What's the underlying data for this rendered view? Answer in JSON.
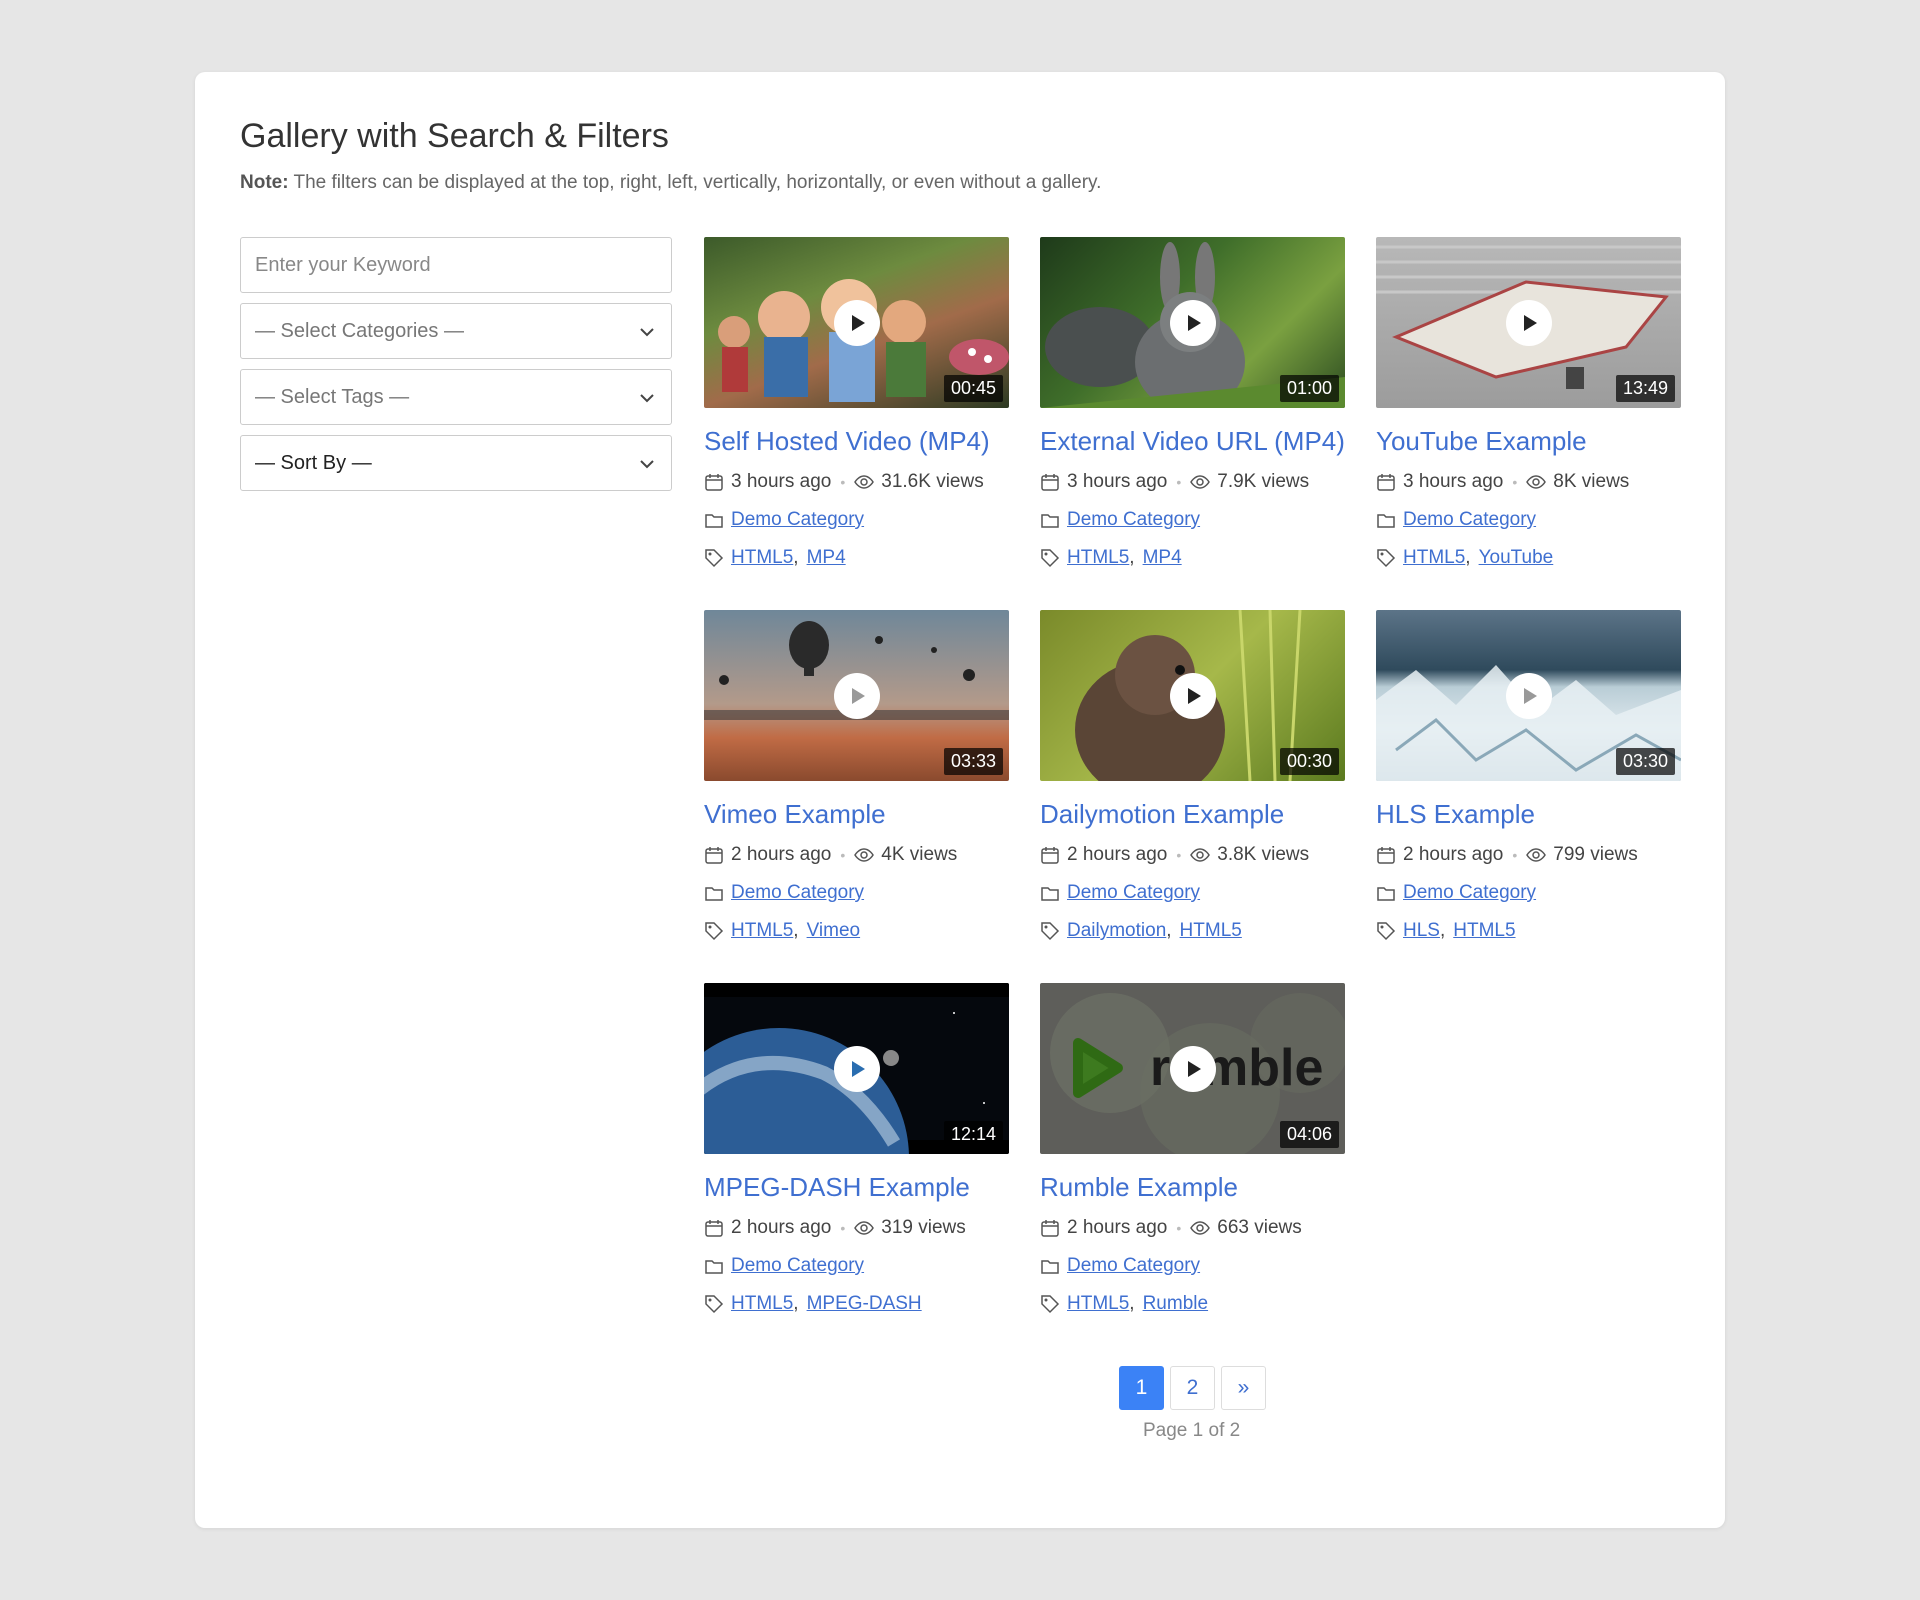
{
  "header": {
    "title": "Gallery with Search & Filters",
    "note_label": "Note:",
    "note_text": "The filters can be displayed at the top, right, left, vertically, horizontally, or even without a gallery."
  },
  "filters": {
    "keyword_placeholder": "Enter your Keyword",
    "categories": "— Select Categories —",
    "tags": "— Select Tags —",
    "sort": "— Sort By —"
  },
  "videos": [
    {
      "title": "Self Hosted Video (MP4)",
      "duration": "00:45",
      "time": "3 hours ago",
      "views": "31.6K views",
      "category": "Demo Category",
      "tag1": "HTML5",
      "tag2": "MP4"
    },
    {
      "title": "External Video URL (MP4)",
      "duration": "01:00",
      "time": "3 hours ago",
      "views": "7.9K views",
      "category": "Demo Category",
      "tag1": "HTML5",
      "tag2": "MP4"
    },
    {
      "title": "YouTube Example",
      "duration": "13:49",
      "time": "3 hours ago",
      "views": "8K views",
      "category": "Demo Category",
      "tag1": "HTML5",
      "tag2": "YouTube"
    },
    {
      "title": "Vimeo Example",
      "duration": "03:33",
      "time": "2 hours ago",
      "views": "4K views",
      "category": "Demo Category",
      "tag1": "HTML5",
      "tag2": "Vimeo"
    },
    {
      "title": "Dailymotion Example",
      "duration": "00:30",
      "time": "2 hours ago",
      "views": "3.8K views",
      "category": "Demo Category",
      "tag1": "Dailymotion",
      "tag2": "HTML5"
    },
    {
      "title": "HLS Example",
      "duration": "03:30",
      "time": "2 hours ago",
      "views": "799 views",
      "category": "Demo Category",
      "tag1": "HLS",
      "tag2": "HTML5"
    },
    {
      "title": "MPEG-DASH Example",
      "duration": "12:14",
      "time": "2 hours ago",
      "views": "319 views",
      "category": "Demo Category",
      "tag1": "HTML5",
      "tag2": "MPEG-DASH"
    },
    {
      "title": "Rumble Example",
      "duration": "04:06",
      "time": "2 hours ago",
      "views": "663 views",
      "category": "Demo Category",
      "tag1": "HTML5",
      "tag2": "Rumble"
    }
  ],
  "rumble_logo": "rumble",
  "pagination": {
    "page1": "1",
    "page2": "2",
    "next": "»",
    "info": "Page 1 of 2"
  },
  "colors": {
    "link": "#3f6fd0",
    "active_page": "#3b82f6"
  }
}
